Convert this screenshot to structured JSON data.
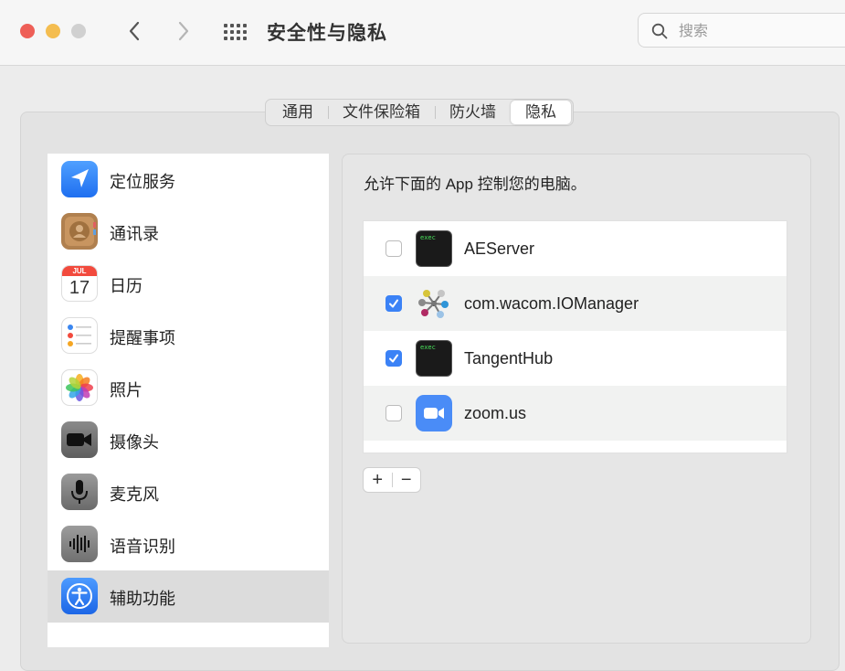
{
  "window": {
    "title": "安全性与隐私",
    "search_placeholder": "搜索"
  },
  "tabs": [
    {
      "label": "通用",
      "active": false
    },
    {
      "label": "文件保险箱",
      "active": false
    },
    {
      "label": "防火墙",
      "active": false
    },
    {
      "label": "隐私",
      "active": true
    }
  ],
  "sidebar": {
    "items": [
      {
        "label": "定位服务",
        "icon": "location-icon"
      },
      {
        "label": "通讯录",
        "icon": "contacts-icon"
      },
      {
        "label": "日历",
        "icon": "calendar-icon",
        "icon_month": "JUL",
        "icon_day": "17"
      },
      {
        "label": "提醒事项",
        "icon": "reminders-icon"
      },
      {
        "label": "照片",
        "icon": "photos-icon"
      },
      {
        "label": "摄像头",
        "icon": "camera-icon"
      },
      {
        "label": "麦克风",
        "icon": "microphone-icon"
      },
      {
        "label": "语音识别",
        "icon": "speech-recognition-icon"
      },
      {
        "label": "辅助功能",
        "icon": "accessibility-icon",
        "selected": true
      }
    ]
  },
  "main": {
    "description": "允许下面的 App 控制您的电脑。",
    "apps": [
      {
        "name": "AEServer",
        "checked": false,
        "icon": "terminal-exec-icon",
        "icon_text": "exec"
      },
      {
        "name": "com.wacom.IOManager",
        "checked": true,
        "icon": "wacom-icon"
      },
      {
        "name": "TangentHub",
        "checked": true,
        "icon": "terminal-exec-icon",
        "icon_text": "exec"
      },
      {
        "name": "zoom.us",
        "checked": false,
        "icon": "zoom-icon"
      }
    ],
    "add_label": "+",
    "remove_label": "−"
  },
  "colors": {
    "accent": "#3b82f6",
    "close": "#ee5f57",
    "minimize": "#f4bd50",
    "zoom_blue": "#4a8cf7"
  }
}
